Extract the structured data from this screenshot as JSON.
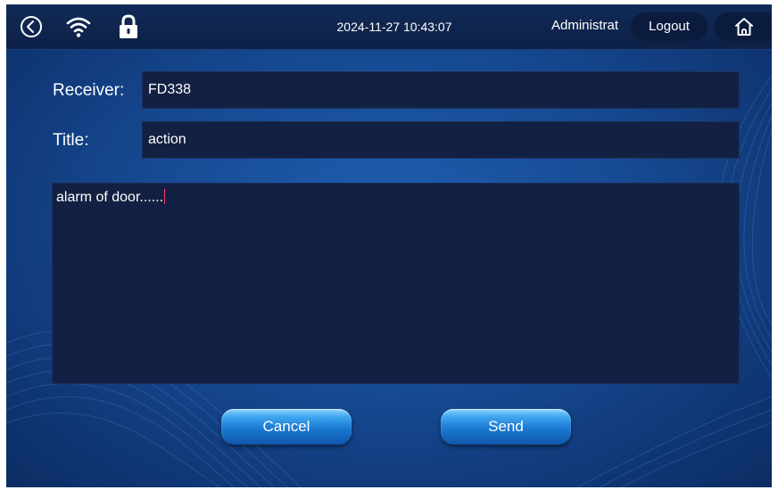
{
  "header": {
    "datetime": "2024-11-27 10:43:07",
    "user": "Administrat",
    "logout_label": "Logout",
    "icons": [
      "back-icon",
      "wifi-icon",
      "lock-icon",
      "home-icon"
    ]
  },
  "form": {
    "receiver_label": "Receiver:",
    "receiver_value": "FD338",
    "title_label": "Title:",
    "title_value": "action",
    "message_value": "alarm of door......"
  },
  "buttons": {
    "cancel_label": "Cancel",
    "send_label": "Send"
  },
  "colors": {
    "background": "#164a93",
    "topbar": "#0e2147",
    "field": "#122143",
    "button": "#1b78d2",
    "caret": "#ff3b6b"
  }
}
